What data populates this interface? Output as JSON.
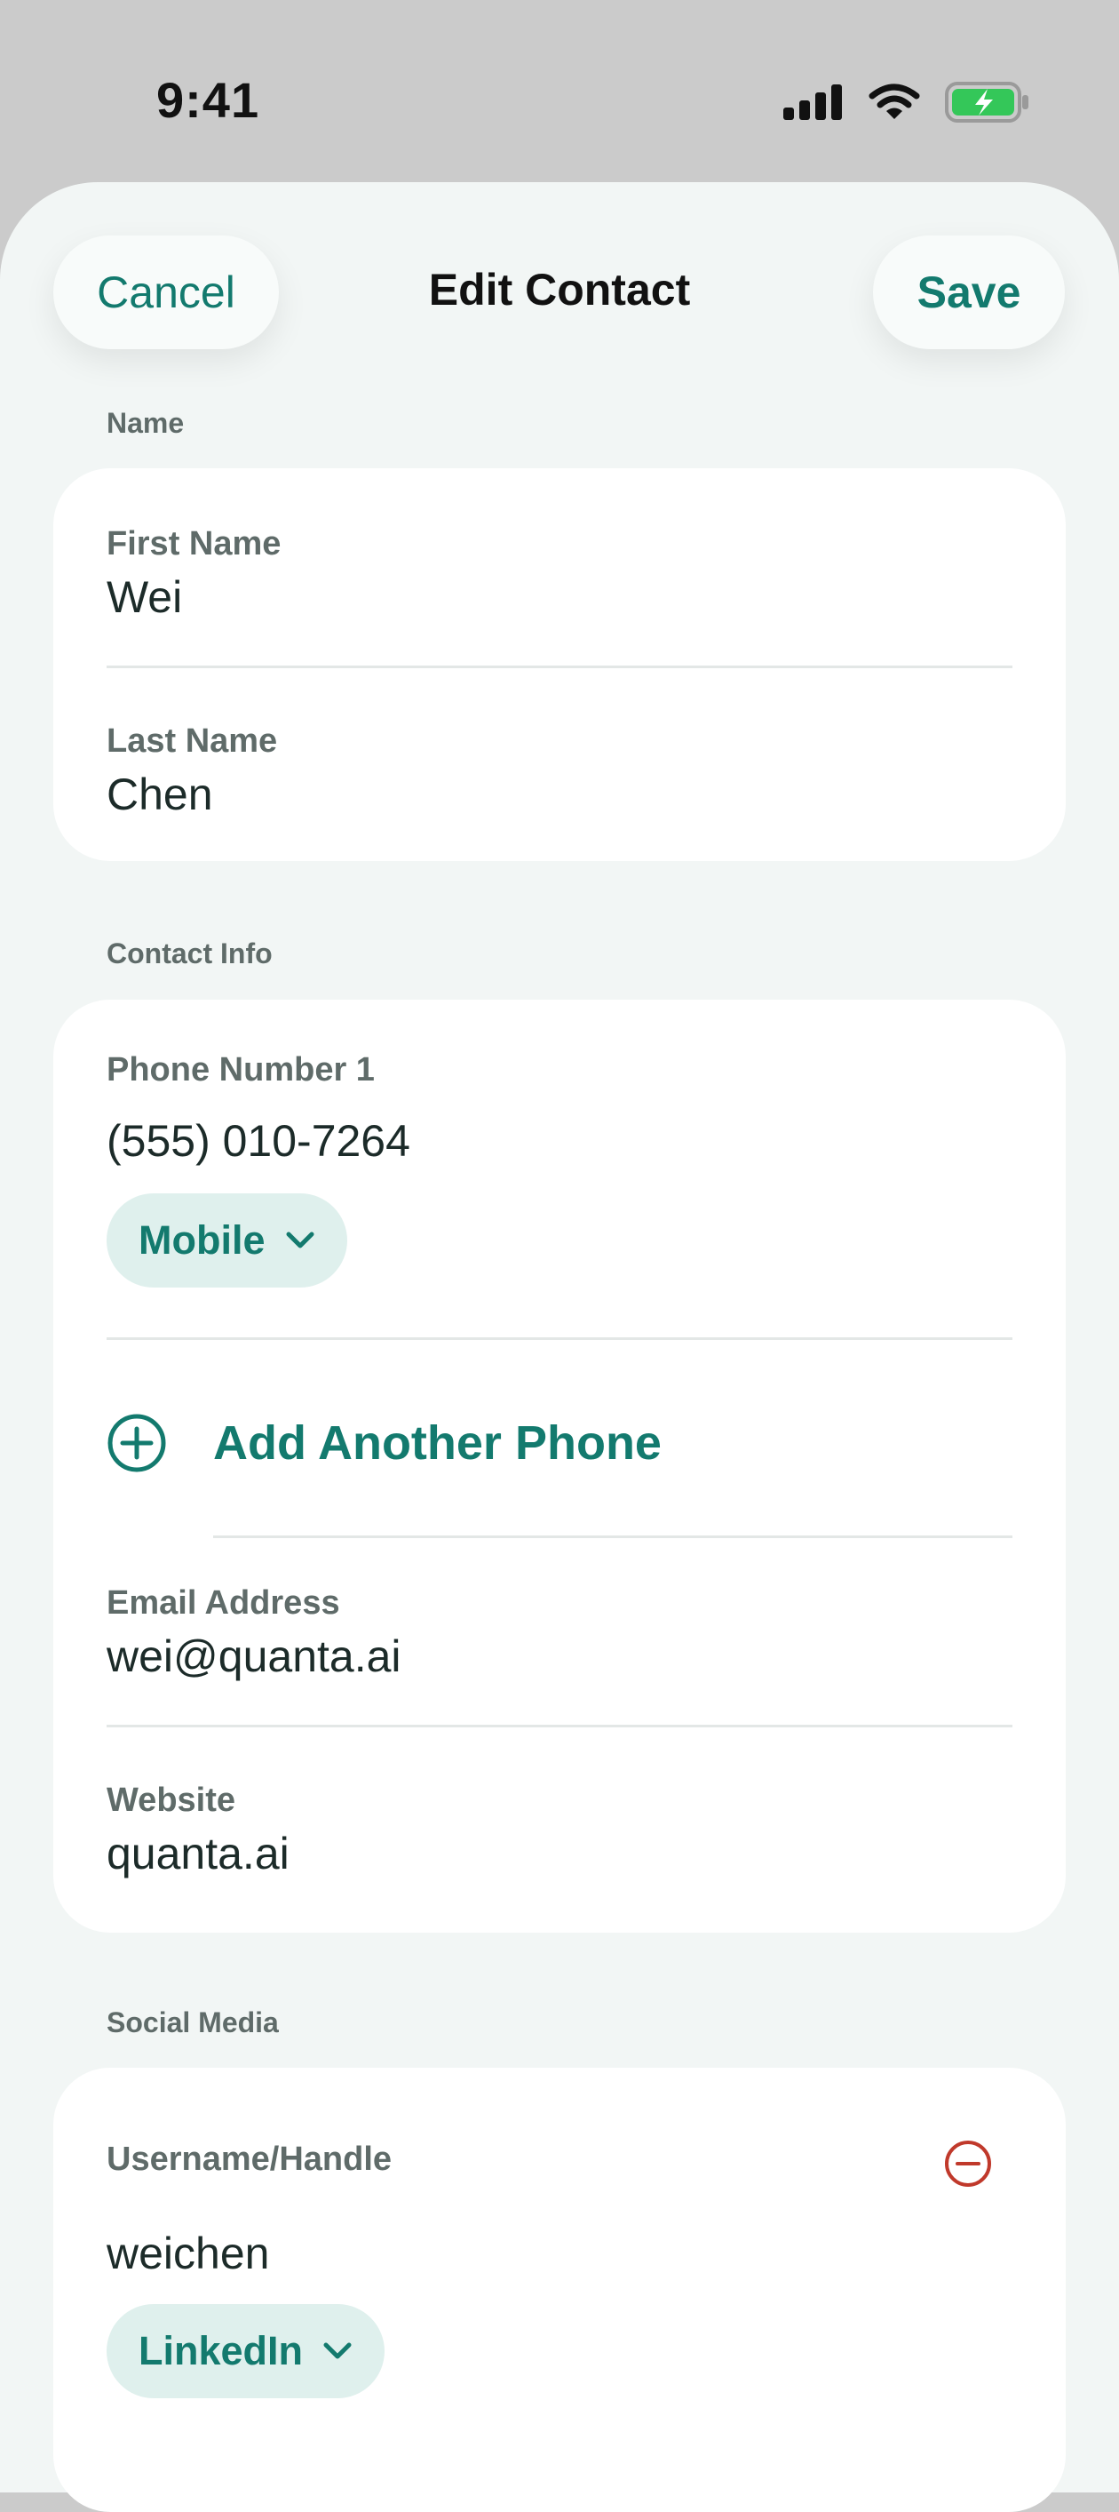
{
  "status_bar": {
    "time": "9:41",
    "icons": [
      "signal-icon",
      "wifi-icon",
      "battery-charging-icon"
    ]
  },
  "header": {
    "title": "Edit Contact",
    "cancel_label": "Cancel",
    "save_label": "Save"
  },
  "sections": {
    "name": {
      "label": "Name",
      "first_name_label": "First Name",
      "first_name_value": "Wei",
      "last_name_label": "Last Name",
      "last_name_value": "Chen"
    },
    "contact_info": {
      "label": "Contact Info",
      "phone_label": "Phone Number 1",
      "phone_value": "(555) 010-7264",
      "phone_type": "Mobile",
      "add_phone_label": "Add Another Phone",
      "email_label": "Email Address",
      "email_value": "wei@quanta.ai",
      "website_label": "Website",
      "website_value": "quanta.ai"
    },
    "social_media": {
      "label": "Social Media",
      "handle_label": "Username/Handle",
      "handle_value": "weichen",
      "platform": "LinkedIn"
    }
  },
  "colors": {
    "accent": "#137a6e",
    "pill_background": "#dff0ed",
    "remove": "#c0392b",
    "battery": "#34c759"
  }
}
